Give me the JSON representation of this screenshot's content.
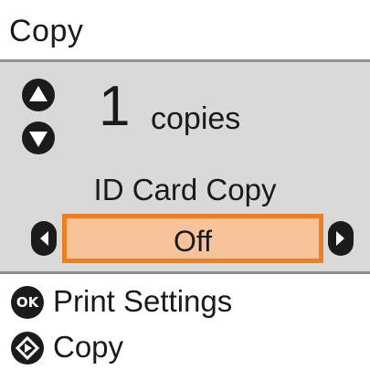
{
  "screen": {
    "title": "Copy"
  },
  "copies": {
    "count": "1",
    "unit": "copies",
    "up_icon": "triangle-up-icon",
    "down_icon": "triangle-down-icon"
  },
  "setting": {
    "label": "ID Card Copy",
    "value": "Off",
    "left_icon": "chevron-left-icon",
    "right_icon": "chevron-right-icon"
  },
  "menu": [
    {
      "icon": "ok-button-icon",
      "icon_text": "OK",
      "label": "Print Settings"
    },
    {
      "icon": "start-diamond-icon",
      "label": "Copy"
    }
  ],
  "colors": {
    "panel": "#d9d9d9",
    "highlight_fill": "#f7c39b",
    "highlight_border": "#f07d1e"
  }
}
